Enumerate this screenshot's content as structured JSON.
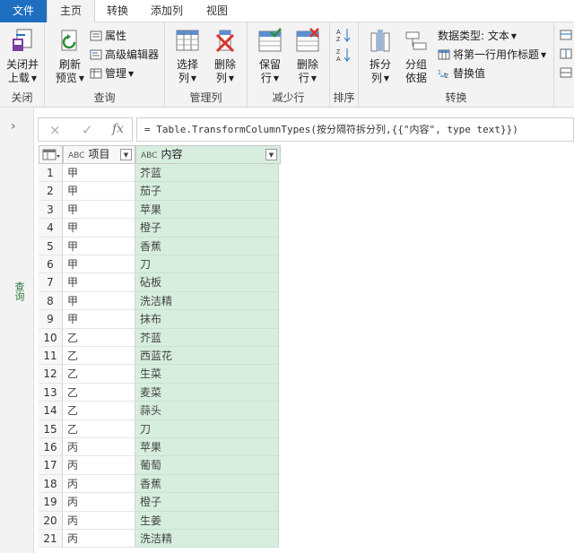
{
  "tabs": [
    "文件",
    "主页",
    "转换",
    "添加列",
    "视图"
  ],
  "ribbon": {
    "close": {
      "btn": "关闭并\n上载",
      "label1": "关闭并",
      "label2": "上载",
      "group": "关闭"
    },
    "query": {
      "refresh1": "刷新",
      "refresh2": "预览",
      "properties": "属性",
      "advanced_editor": "高级编辑器",
      "manage": "管理",
      "group": "查询"
    },
    "manage_columns": {
      "choose1": "选择",
      "choose2": "列",
      "remove1": "删除",
      "remove2": "列",
      "group": "管理列"
    },
    "reduce_rows": {
      "keep1": "保留",
      "keep2": "行",
      "remove1": "删除",
      "remove2": "行",
      "group": "减少行"
    },
    "sort": {
      "group": "排序"
    },
    "transform": {
      "split1": "拆分",
      "split2": "列",
      "groupby1": "分组",
      "groupby2": "依据",
      "datatype": "数据类型: 文本",
      "first_row_header": "将第一行用作标题",
      "replace_values": "替换值",
      "group": "转换"
    }
  },
  "side_panel": {
    "label": "查询"
  },
  "formula_bar": {
    "cancel_icon": "×",
    "confirm_icon": "✓",
    "fx": "fx",
    "formula": "= Table.TransformColumnTypes(按分隔符拆分列,{{\"内容\", type text}})"
  },
  "table": {
    "type_badge": "ABC",
    "columns": [
      "项目",
      "内容"
    ],
    "rows": [
      [
        "1",
        "甲",
        "芥蓝"
      ],
      [
        "2",
        "甲",
        "茄子"
      ],
      [
        "3",
        "甲",
        "苹果"
      ],
      [
        "4",
        "甲",
        "橙子"
      ],
      [
        "5",
        "甲",
        "香蕉"
      ],
      [
        "6",
        "甲",
        "刀"
      ],
      [
        "7",
        "甲",
        "砧板"
      ],
      [
        "8",
        "甲",
        "洗洁精"
      ],
      [
        "9",
        "甲",
        "抹布"
      ],
      [
        "10",
        "乙",
        "芥蓝"
      ],
      [
        "11",
        "乙",
        "西蓝花"
      ],
      [
        "12",
        "乙",
        "生菜"
      ],
      [
        "13",
        "乙",
        "麦菜"
      ],
      [
        "14",
        "乙",
        "蒜头"
      ],
      [
        "15",
        "乙",
        "刀"
      ],
      [
        "16",
        "丙",
        "苹果"
      ],
      [
        "17",
        "丙",
        "葡萄"
      ],
      [
        "18",
        "丙",
        "香蕉"
      ],
      [
        "19",
        "丙",
        "橙子"
      ],
      [
        "20",
        "丙",
        "生姜"
      ],
      [
        "21",
        "丙",
        "洗洁精"
      ]
    ]
  },
  "colors": {
    "file_tab": "#1e6fc0",
    "content_column": "#d7eedf",
    "query_label": "#2a7a3e"
  }
}
